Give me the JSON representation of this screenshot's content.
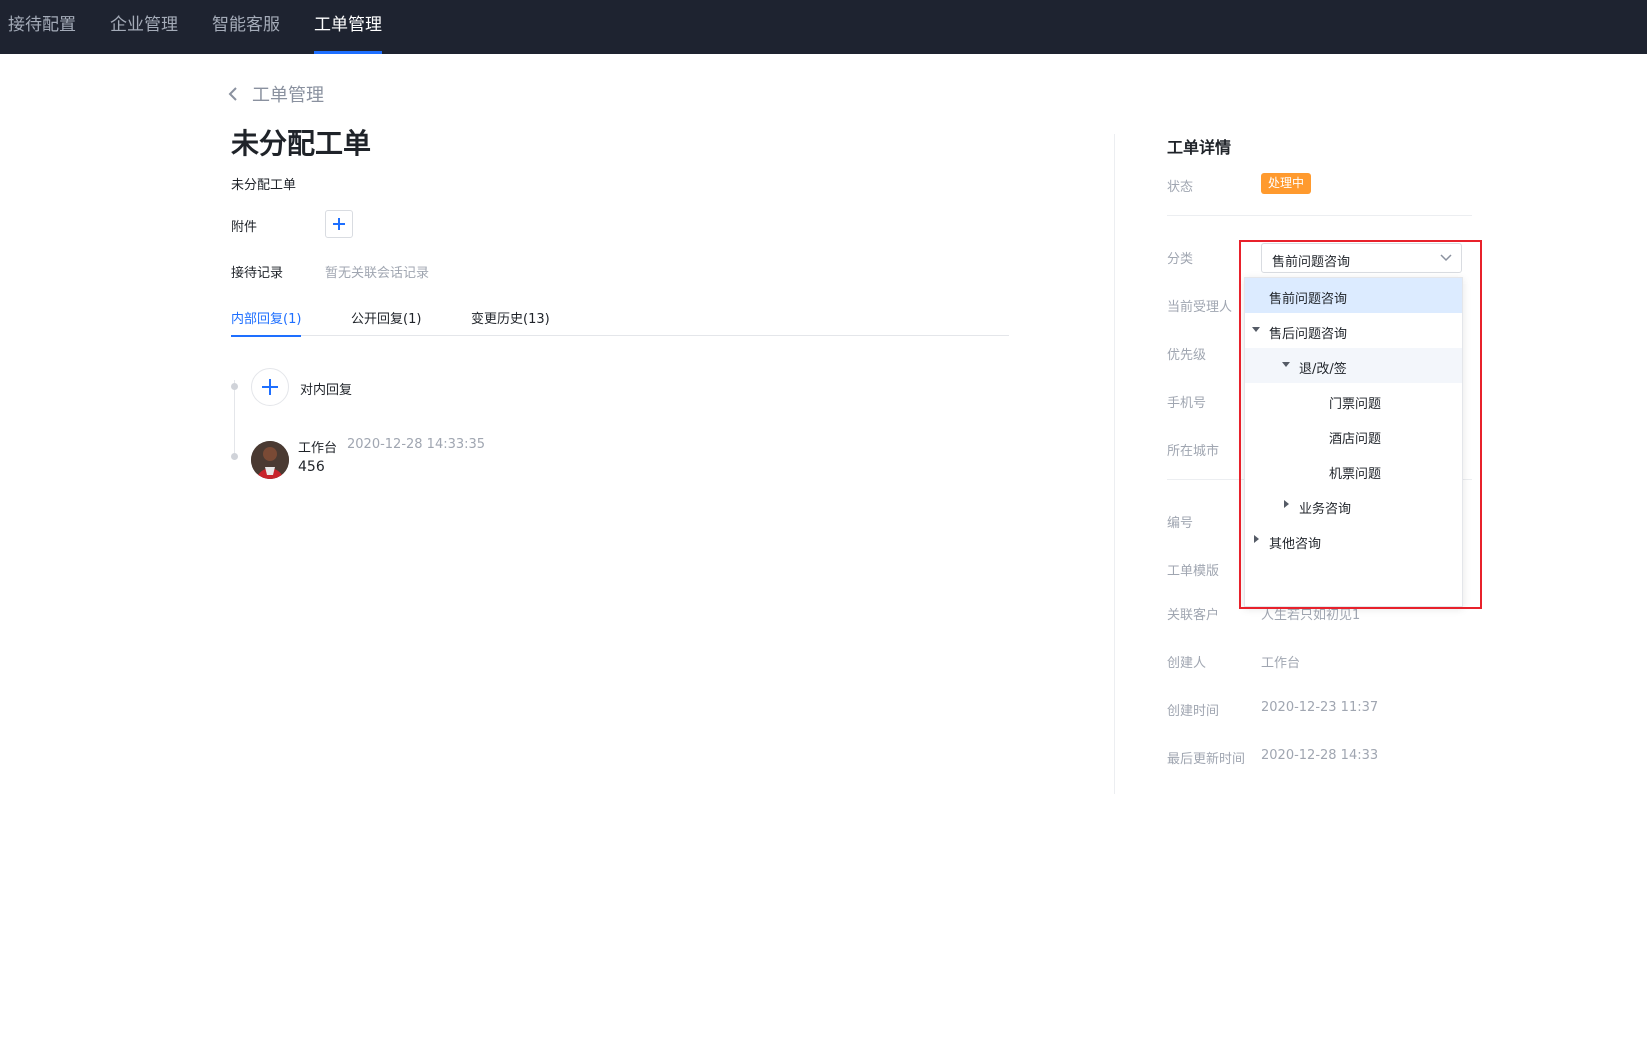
{
  "topnav": {
    "items": [
      {
        "label": "接待配置",
        "active": false
      },
      {
        "label": "企业管理",
        "active": false
      },
      {
        "label": "智能客服",
        "active": false
      },
      {
        "label": "工单管理",
        "active": true
      }
    ]
  },
  "main": {
    "back_label": "工单管理",
    "title": "未分配工单",
    "subtitle": "未分配工单",
    "attachment_label": "附件",
    "record_label": "接待记录",
    "record_empty": "暂无关联会话记录",
    "tabs": [
      {
        "label": "内部回复(1)",
        "active": true
      },
      {
        "label": "公开回复(1)",
        "active": false
      },
      {
        "label": "变更历史(13)",
        "active": false
      }
    ],
    "reply_add_label": "对内回复",
    "entries": [
      {
        "author": "工作台",
        "time": "2020-12-28 14:33:35",
        "content": "456"
      }
    ]
  },
  "detail": {
    "title": "工单详情",
    "status_label": "状态",
    "status_value": "处理中",
    "status_color": "#ff9a2e",
    "category_label": "分类",
    "category_value": "售前问题咨询",
    "assignee_label": "当前受理人",
    "priority_label": "优先级",
    "phone_label": "手机号",
    "city_label": "所在城市",
    "number_label": "编号",
    "template_label": "工单模版",
    "customer_label": "关联客户",
    "customer_value": "人生若只如初见1",
    "creator_label": "创建人",
    "creator_value": "工作台",
    "created_label": "创建时间",
    "created_value": "2020-12-23 11:37",
    "updated_label": "最后更新时间",
    "updated_value": "2020-12-28 14:33"
  },
  "dropdown": {
    "items": [
      {
        "label": "售前问题咨询",
        "level": 0,
        "caret": "none",
        "state": "selected"
      },
      {
        "label": "售后问题咨询",
        "level": 0,
        "caret": "down",
        "state": "normal"
      },
      {
        "label": "退/改/签",
        "level": 1,
        "caret": "down",
        "state": "hover"
      },
      {
        "label": "门票问题",
        "level": 2,
        "caret": "none",
        "state": "normal"
      },
      {
        "label": "酒店问题",
        "level": 2,
        "caret": "none",
        "state": "normal"
      },
      {
        "label": "机票问题",
        "level": 2,
        "caret": "none",
        "state": "normal"
      },
      {
        "label": "业务咨询",
        "level": 1,
        "caret": "right",
        "state": "normal"
      },
      {
        "label": "其他咨询",
        "level": 0,
        "caret": "right",
        "state": "normal"
      }
    ]
  },
  "colors": {
    "accent": "#1e6fff",
    "nav_bg": "#1e2330",
    "highlight": "#e8212b"
  }
}
